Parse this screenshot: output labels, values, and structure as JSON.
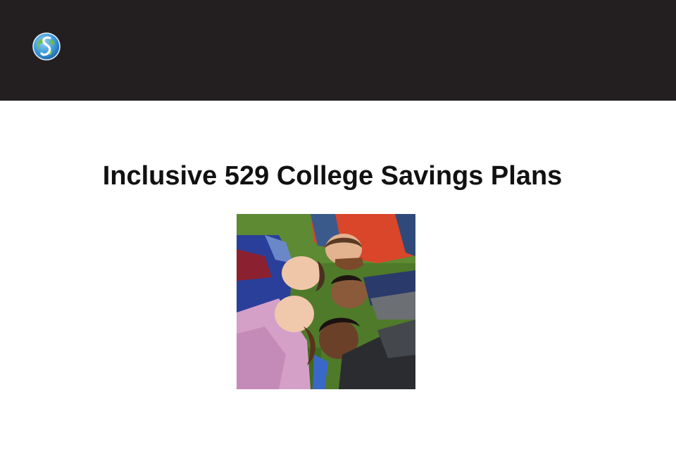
{
  "slide": {
    "title": "Inclusive 529 College Savings Plans",
    "logo_icon": "globe-s-logo-icon",
    "photo_description_icon": "children-circle-photo"
  },
  "colors": {
    "header_background": "#231f20",
    "title_text": "#111111",
    "page_background": "#ffffff"
  }
}
